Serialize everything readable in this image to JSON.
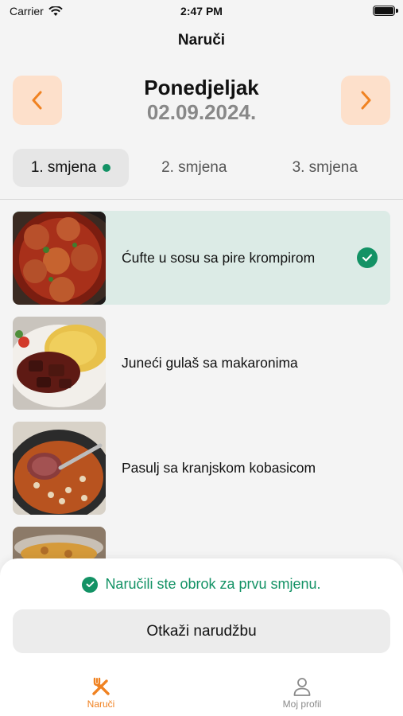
{
  "status_bar": {
    "carrier": "Carrier",
    "time": "2:47 PM"
  },
  "nav": {
    "title": "Naruči"
  },
  "date_header": {
    "day": "Ponedjeljak",
    "date": "02.09.2024."
  },
  "tabs": [
    {
      "label": "1. smjena",
      "active": true
    },
    {
      "label": "2. smjena",
      "active": false
    },
    {
      "label": "3. smjena",
      "active": false
    }
  ],
  "meals": [
    {
      "name": "Ćufte u sosu sa pire krompirom",
      "selected": true,
      "icon": "meatballs-photo"
    },
    {
      "name": "Juneći gulaš sa makaronima",
      "selected": false,
      "icon": "goulash-photo"
    },
    {
      "name": "Pasulj sa kranjskom kobasicom",
      "selected": false,
      "icon": "bean-stew-photo"
    },
    {
      "name": "",
      "selected": false,
      "icon": "dish-photo"
    }
  ],
  "sheet": {
    "message": "Naručili ste obrok za prvu smjenu.",
    "cancel_label": "Otkaži narudžbu"
  },
  "tabbar": {
    "order_label": "Naruči",
    "profile_label": "Moj profil"
  },
  "colors": {
    "accent": "#f08221",
    "success": "#139265",
    "selected_row": "#dcebe6",
    "nav_button_bg": "#fde0cb"
  }
}
